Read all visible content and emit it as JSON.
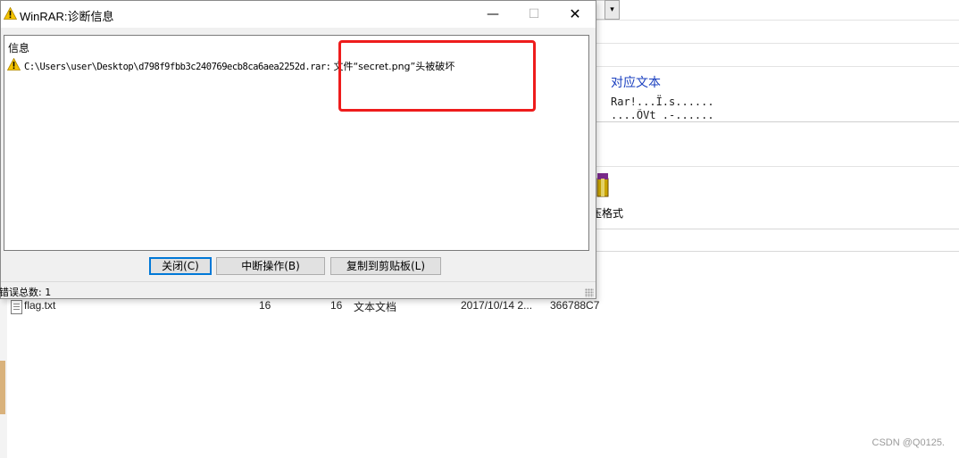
{
  "dialog": {
    "title": "WinRAR:诊断信息",
    "min_symbol": "—",
    "max_symbol": "☐",
    "close_symbol": "✕",
    "header": "信息",
    "message_path": "C:\\Users\\user\\Desktop\\d798f9fbb3c240769ecb8ca6aea2252d.rar:",
    "message_text": "文件“secret.png”头被破坏",
    "buttons": {
      "close": "关闭(C)",
      "abort": "中断操作(B)",
      "copy": "复制到剪贴板(L)"
    },
    "status": "错误总数: 1"
  },
  "background": {
    "hex_panel_title": "对应文本",
    "hex_line_1": "Rar!...Ï.s......",
    "hex_line_2": "....ÕVt .-......",
    "toolbar_label": "压格式",
    "combo_arrow": "▾",
    "file_row": {
      "name": "flag.txt",
      "size": "16",
      "packed": "16",
      "type": "文本文档",
      "modified": "2017/10/14 2...",
      "crc": "366788C7"
    }
  },
  "watermark": "CSDN @Q0125.",
  "colors": {
    "highlight_border": "#ee1c1c",
    "primary_button_border": "#0078d7",
    "hex_title": "#1a3fbf",
    "warning_icon": "#f5c400"
  },
  "icons": {
    "warning": "warning-icon",
    "text_file": "text-file-icon",
    "archive": "archive-icon"
  }
}
